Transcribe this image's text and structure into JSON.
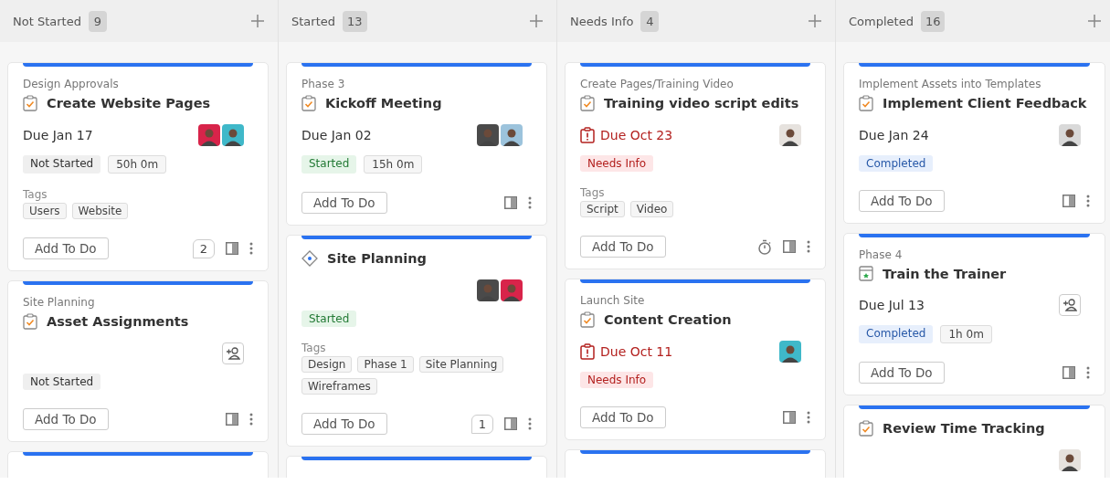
{
  "columns": [
    {
      "title": "Not Started",
      "count": "9",
      "cards": [
        {
          "kind": "task",
          "parent": "Design Approvals",
          "title": "Create Website Pages",
          "due": "Due Jan 17",
          "avatars": [
            {
              "color": "#d8244a"
            },
            {
              "color": "#3fb8c9"
            }
          ],
          "status": {
            "label": "Not Started",
            "kind": "not_started"
          },
          "time": "50h 0m",
          "tags_label": "Tags",
          "tags": [
            "Users",
            "Website"
          ],
          "button": "Add To Do",
          "comments": "2"
        },
        {
          "kind": "task",
          "parent": "Site Planning",
          "title": "Asset Assignments",
          "assign": true,
          "status": {
            "label": "Not Started",
            "kind": "not_started"
          },
          "button": "Add To Do"
        },
        {
          "kind": "stub"
        }
      ]
    },
    {
      "title": "Started",
      "count": "13",
      "cards": [
        {
          "kind": "task",
          "parent": "Phase 3",
          "title": "Kickoff Meeting",
          "due": "Due Jan 02",
          "avatars": [
            {
              "color": "#4a4a4a"
            },
            {
              "color": "#9cc3dc"
            }
          ],
          "status": {
            "label": "Started",
            "kind": "started"
          },
          "time": "15h 0m",
          "button": "Add To Do"
        },
        {
          "kind": "milestone",
          "title": "Site Planning",
          "avatars": [
            {
              "color": "#4a4a4a"
            },
            {
              "color": "#d8244a"
            }
          ],
          "status": {
            "label": "Started",
            "kind": "started"
          },
          "tags_label": "Tags",
          "tags": [
            "Design",
            "Phase 1",
            "Site Planning",
            "Wireframes"
          ],
          "button": "Add To Do",
          "comments": "1"
        },
        {
          "kind": "stub"
        }
      ]
    },
    {
      "title": "Needs Info",
      "count": "4",
      "cards": [
        {
          "kind": "task",
          "parent": "Create Pages/Training Video",
          "title": "Training video script edits",
          "due": "Due Oct 23",
          "overdue": true,
          "avatars": [
            {
              "color": "#e6e2de"
            }
          ],
          "status": {
            "label": "Needs Info",
            "kind": "needs_info"
          },
          "tags_label": "Tags",
          "tags": [
            "Script",
            "Video"
          ],
          "button": "Add To Do",
          "timer": true
        },
        {
          "kind": "task",
          "parent": "Launch Site",
          "title": "Content Creation",
          "due": "Due Oct 11",
          "overdue": true,
          "avatars": [
            {
              "color": "#3fb8c9"
            }
          ],
          "status": {
            "label": "Needs Info",
            "kind": "needs_info"
          },
          "button": "Add To Do"
        },
        {
          "kind": "stub"
        }
      ]
    },
    {
      "title": "Completed",
      "count": "16",
      "cards": [
        {
          "kind": "task",
          "parent": "Implement Assets into Templates",
          "title": "Implement Client Feedback",
          "due": "Due Jan 24",
          "avatars": [
            {
              "color": "#d9d9d9"
            }
          ],
          "status": {
            "label": "Completed",
            "kind": "completed"
          },
          "button": "Add To Do"
        },
        {
          "kind": "event",
          "parent": "Phase 4",
          "title": "Train the Trainer",
          "due": "Due Jul 13",
          "assign": true,
          "status": {
            "label": "Completed",
            "kind": "completed"
          },
          "time": "1h 0m",
          "button": "Add To Do"
        },
        {
          "kind": "task",
          "title": "Review Time Tracking",
          "avatars": [
            {
              "color": "#e6e2de"
            }
          ]
        }
      ]
    }
  ]
}
